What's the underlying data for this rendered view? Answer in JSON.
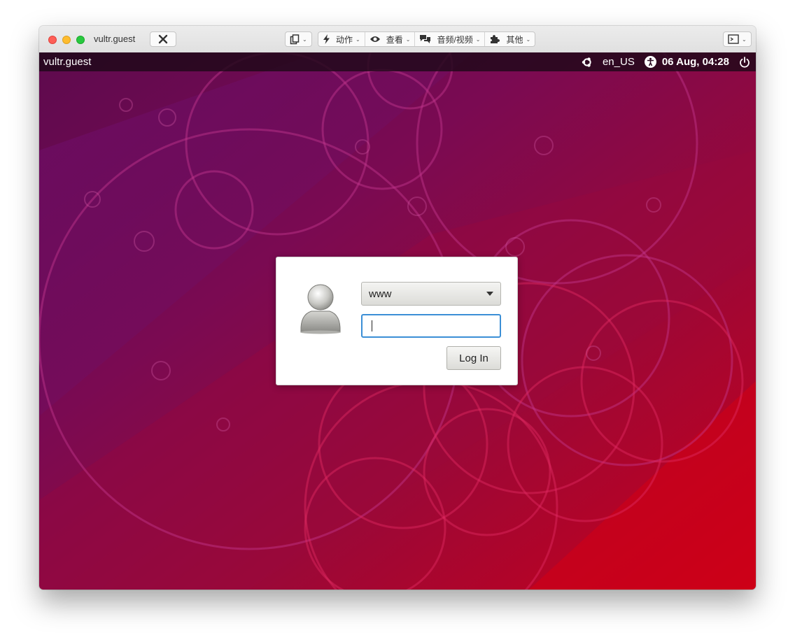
{
  "window": {
    "title": "vultr.guest",
    "toolbar": {
      "actions_label": "动作",
      "view_label": "查看",
      "av_label": "音频/视频",
      "other_label": "其他"
    }
  },
  "panel": {
    "hostname": "vultr.guest",
    "locale": "en_US",
    "datetime": "06 Aug, 04:28"
  },
  "login": {
    "selected_user": "www",
    "password_value": "",
    "login_button": "Log In"
  },
  "colors": {
    "wallpaper_top": "#6a0a52",
    "wallpaper_bottom": "#c8001a",
    "focus_border": "#3b8fd6"
  },
  "icons": [
    "close-icon",
    "clipboard-icon",
    "lightning-icon",
    "eye-icon",
    "chat-icon",
    "puzzle-icon",
    "terminal-icon",
    "ubuntu-icon",
    "accessibility-icon",
    "power-icon",
    "user-avatar-icon"
  ]
}
